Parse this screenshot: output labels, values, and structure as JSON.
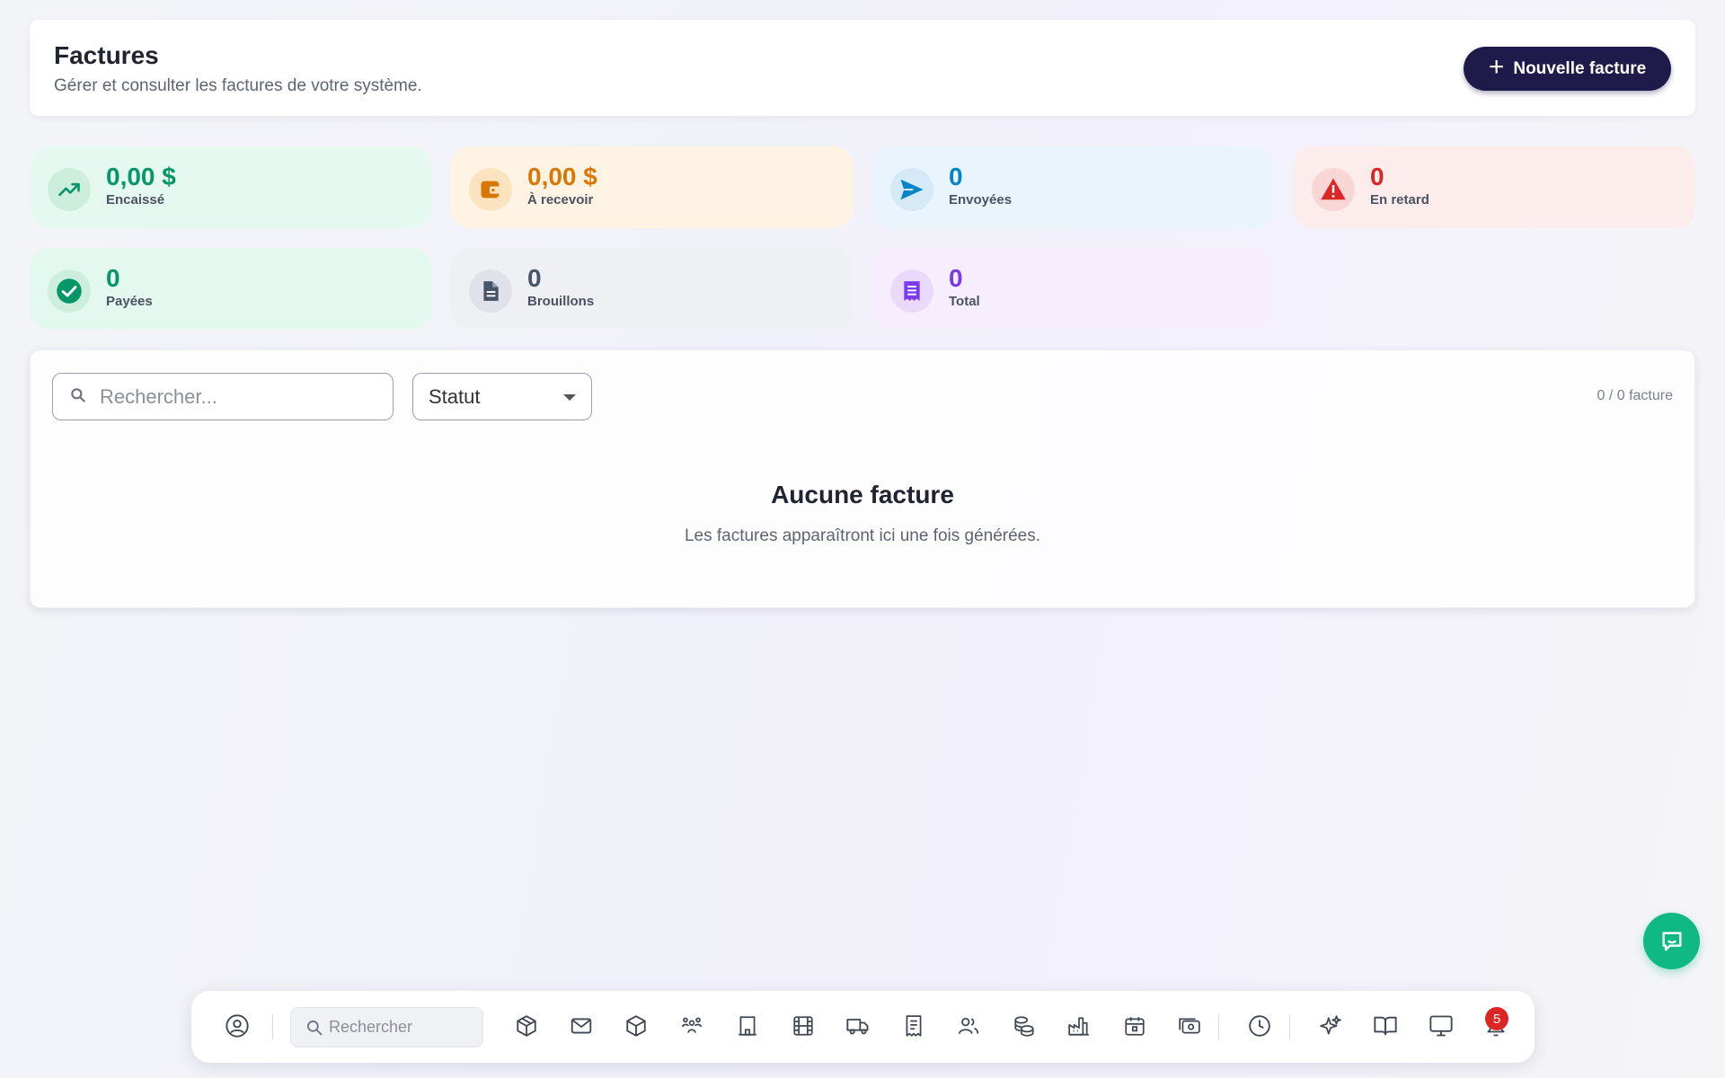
{
  "header": {
    "title": "Factures",
    "subtitle": "Gérer et consulter les factures de votre système.",
    "new_button_label": "Nouvelle facture"
  },
  "stats": [
    {
      "value": "0,00 $",
      "label": "Encaissé",
      "color": "#059669",
      "bg": "#e6f9f0",
      "icon": "trending-up-icon"
    },
    {
      "value": "0,00 $",
      "label": "À recevoir",
      "color": "#d97706",
      "bg": "#fff4e4",
      "icon": "wallet-icon"
    },
    {
      "value": "0",
      "label": "Envoyées",
      "color": "#0284c7",
      "bg": "#eaf4fc",
      "icon": "send-icon"
    },
    {
      "value": "0",
      "label": "En retard",
      "color": "#dc2626",
      "bg": "#fdecec",
      "icon": "alert-triangle-icon"
    },
    {
      "value": "0",
      "label": "Payées",
      "color": "#059669",
      "bg": "#e3f8ee",
      "icon": "check-circle-icon"
    },
    {
      "value": "0",
      "label": "Brouillons",
      "color": "#475569",
      "bg": "#eef0f4",
      "icon": "document-icon"
    },
    {
      "value": "0",
      "label": "Total",
      "color": "#7c3aed",
      "bg": "#f6eefc",
      "icon": "receipt-icon"
    }
  ],
  "filters": {
    "search_placeholder": "Rechercher...",
    "status_label": "Statut",
    "count_label": "0 / 0 facture"
  },
  "empty_state": {
    "title": "Aucune facture",
    "text": "Les factures apparaîtront ici une fois générées."
  },
  "dock": {
    "search_placeholder": "Rechercher",
    "notification_count": "5",
    "icons": [
      "user-circle-icon",
      "box-icon",
      "mail-icon",
      "package-icon",
      "team-icon",
      "building-icon",
      "film-icon",
      "truck-icon",
      "receipt-icon",
      "users-icon",
      "coins-icon",
      "factory-icon",
      "calendar-icon",
      "money-icon",
      "clock-icon",
      "sparkles-icon",
      "book-icon",
      "monitor-icon",
      "bell-icon"
    ]
  },
  "colors": {
    "primary": "#1e1b4b",
    "chat_fab": "#10b981"
  }
}
